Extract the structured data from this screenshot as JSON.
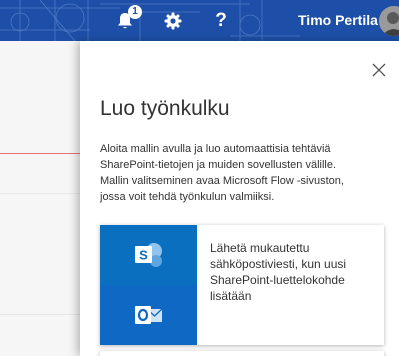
{
  "suitebar": {
    "notification_count": "1",
    "help_label": "?",
    "user_name": "Timo Pertila",
    "icons": [
      "bell-icon",
      "gear-icon",
      "help-icon"
    ],
    "brand_color": "#1d4fa8"
  },
  "panel": {
    "title": "Luo työnkulku",
    "description_lines": [
      "Aloita mallin avulla ja luo automaattisia tehtäviä",
      "SharePoint-tietojen ja muiden sovellusten välille.",
      "Mallin valitseminen avaa Microsoft Flow -sivuston,",
      "jossa voit tehdä työnkulun valmiiksi."
    ],
    "templates": [
      {
        "title_lines": [
          "Lähetä mukautettu",
          "sähköpostiviesti, kun uusi",
          "SharePoint-luettelokohde",
          "lisätään"
        ],
        "icons": [
          "sharepoint-icon",
          "outlook-icon"
        ],
        "icon_colors": [
          "#0b6fbf",
          "#0f69c4"
        ]
      }
    ]
  }
}
